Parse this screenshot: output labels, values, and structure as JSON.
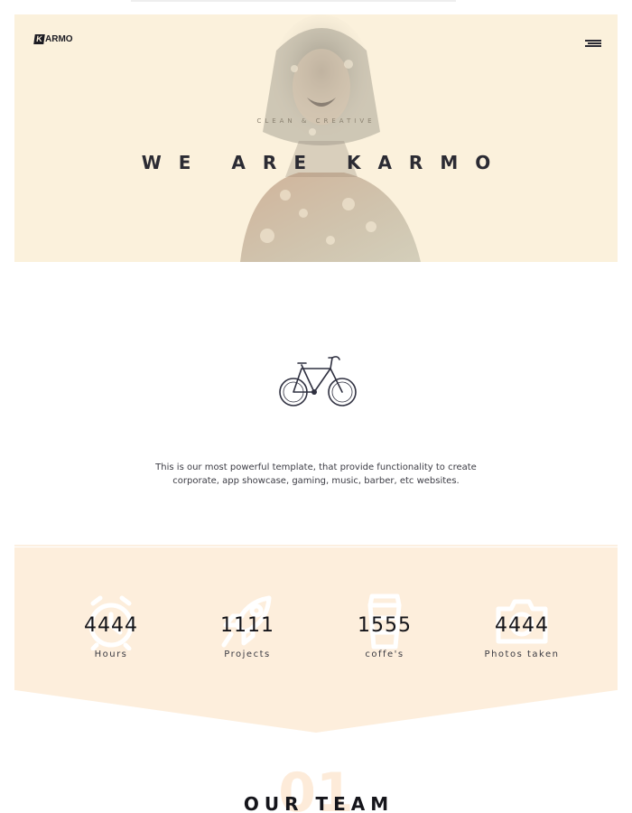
{
  "header": {
    "logo_mark": "K",
    "logo_text": "ARMO",
    "menu_icon": "hamburger-menu-icon"
  },
  "hero": {
    "subtitle": "CLEAN & CREATIVE",
    "title": "WE ARE KARMO",
    "background_color": "#fbf1dc"
  },
  "intro": {
    "icon": "bicycle-icon",
    "text": "This is our most powerful template, that provide functionality to create corporate, app showcase, gaming, music, barber, etc websites."
  },
  "stats": {
    "background_color": "#fdeedc",
    "items": [
      {
        "value": "4444",
        "label": "Hours",
        "icon": "alarm-clock-icon"
      },
      {
        "value": "1111",
        "label": "Projects",
        "icon": "rocket-icon"
      },
      {
        "value": "1555",
        "label": "coffe's",
        "icon": "coffee-cup-icon"
      },
      {
        "value": "4444",
        "label": "Photos taken",
        "icon": "camera-icon"
      }
    ]
  },
  "team": {
    "number": "01",
    "title": "OUR TEAM"
  }
}
